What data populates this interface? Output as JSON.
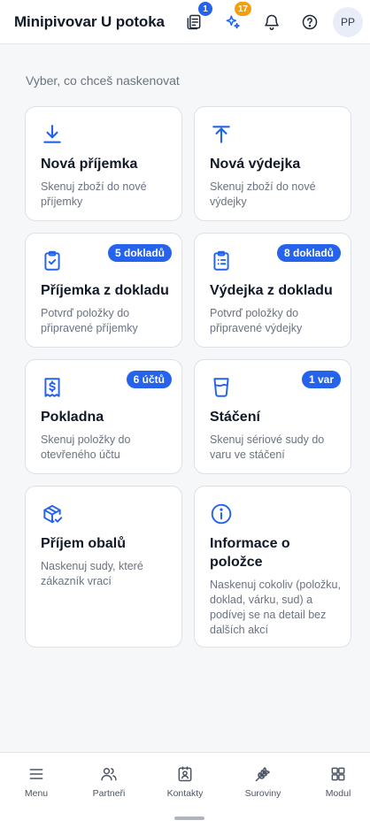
{
  "colors": {
    "accent": "#2563eb",
    "badge_orange": "#f59e0b",
    "text_muted": "#6b7280"
  },
  "header": {
    "title": "Minipivovar U potoka",
    "icons": [
      {
        "name": "documents-icon",
        "badge": "1"
      },
      {
        "name": "sparkle-icon",
        "badge": "17"
      },
      {
        "name": "bell-icon"
      },
      {
        "name": "help-icon"
      }
    ],
    "avatar_initials": "PP"
  },
  "main": {
    "subtitle": "Vyber, co chceš naskenovat",
    "cards": [
      {
        "icon": "download-icon",
        "title": "Nová příjemka",
        "desc": "Skenuj zboží do nové příjemky"
      },
      {
        "icon": "upload-icon",
        "title": "Nová výdejka",
        "desc": "Skenuj zboží do nové výdejky"
      },
      {
        "icon": "clipboard-check-icon",
        "title": "Příjemka z dokladu",
        "desc": "Potvrď položky do připravené příjemky",
        "badge": "5 dokladů"
      },
      {
        "icon": "clipboard-list-icon",
        "title": "Výdejka z dokladu",
        "desc": "Potvrď položky do připravené výdejky",
        "badge": "8 dokladů"
      },
      {
        "icon": "receipt-icon",
        "title": "Pokladna",
        "desc": "Skenuj položky do otevřeného účtu",
        "badge": "6 účtů"
      },
      {
        "icon": "glass-icon",
        "title": "Stáčení",
        "desc": "Skenuj sériové sudy do varu ve stáčení",
        "badge": "1 var"
      },
      {
        "icon": "package-check-icon",
        "title": "Příjem obalů",
        "desc": "Naskenuj sudy, které zákazník vrací"
      },
      {
        "icon": "info-icon",
        "title": "Informace o položce",
        "desc": "Naskenuj cokoliv (položku, doklad, várku, sud) a podívej se na detail bez dalších akcí"
      }
    ]
  },
  "bottom_nav": {
    "items": [
      {
        "icon": "menu-icon",
        "label": "Menu"
      },
      {
        "icon": "users-icon",
        "label": "Partneři"
      },
      {
        "icon": "contact-icon",
        "label": "Kontakty"
      },
      {
        "icon": "wheat-icon",
        "label": "Suroviny"
      },
      {
        "icon": "grid-icon",
        "label": "Modul"
      }
    ]
  }
}
